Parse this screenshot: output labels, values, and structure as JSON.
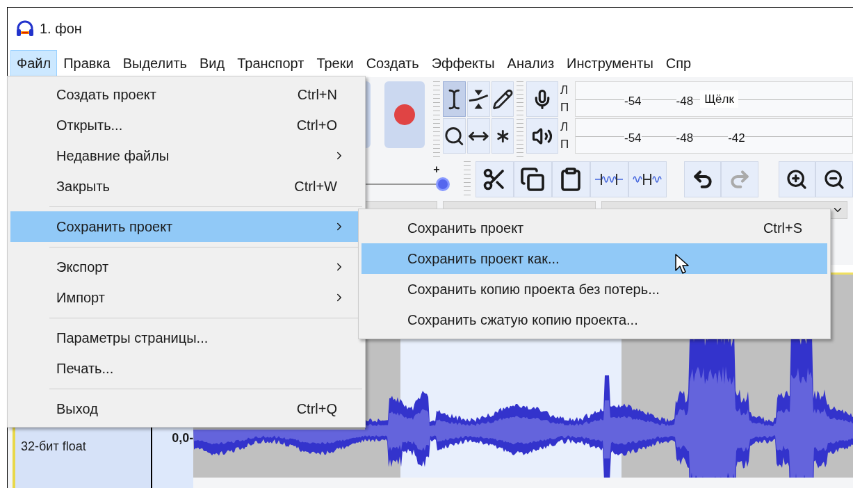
{
  "window": {
    "title": "1. фон"
  },
  "menu_bar": [
    {
      "label": "Файл",
      "selected": true
    },
    {
      "label": "Правка",
      "selected": false
    },
    {
      "label": "Выделить",
      "selected": false
    },
    {
      "label": "Вид",
      "selected": false
    },
    {
      "label": "Транспорт",
      "selected": false
    },
    {
      "label": "Треки",
      "selected": false
    },
    {
      "label": "Создать",
      "selected": false
    },
    {
      "label": "Эффекты",
      "selected": false
    },
    {
      "label": "Анализ",
      "selected": false
    },
    {
      "label": "Инструменты",
      "selected": false
    },
    {
      "label": "Спр",
      "selected": false
    }
  ],
  "tools": [
    {
      "selected": true
    },
    {
      "selected": false
    },
    {
      "selected": false
    },
    {
      "selected": false
    },
    {
      "selected": false
    },
    {
      "selected": false
    }
  ],
  "meters": [
    {
      "channels": [
        "Л",
        "П"
      ],
      "scale": [
        "-54",
        "-48"
      ],
      "hint": "Щёлк"
    },
    {
      "channels": [
        "Л",
        "П"
      ],
      "scale": [
        "-54",
        "-48",
        "-42"
      ]
    }
  ],
  "slider": {
    "mark": "+",
    "level": 1
  },
  "file_menu": [
    {
      "kind": "item",
      "label": "Создать проект",
      "shortcut": "Ctrl+N",
      "submenu": false,
      "selected": false
    },
    {
      "kind": "item",
      "label": "Открыть...",
      "shortcut": "Ctrl+O",
      "submenu": false,
      "selected": false
    },
    {
      "kind": "item",
      "label": "Недавние файлы",
      "submenu": true,
      "selected": false
    },
    {
      "kind": "item",
      "label": "Закрыть",
      "shortcut": "Ctrl+W",
      "submenu": false,
      "selected": false
    },
    {
      "kind": "separator"
    },
    {
      "kind": "item",
      "label": "Сохранить проект",
      "submenu": true,
      "selected": true
    },
    {
      "kind": "separator"
    },
    {
      "kind": "item",
      "label": "Экспорт",
      "submenu": true,
      "selected": false
    },
    {
      "kind": "item",
      "label": "Импорт",
      "submenu": true,
      "selected": false
    },
    {
      "kind": "separator"
    },
    {
      "kind": "item",
      "label": "Параметры страницы...",
      "submenu": false,
      "selected": false
    },
    {
      "kind": "item",
      "label": "Печать...",
      "submenu": false,
      "selected": false
    },
    {
      "kind": "separator"
    },
    {
      "kind": "item",
      "label": "Выход",
      "shortcut": "Ctrl+Q",
      "submenu": false,
      "selected": false
    }
  ],
  "save_submenu": [
    {
      "label": "Сохранить проект",
      "shortcut": "Ctrl+S",
      "selected": false
    },
    {
      "label": "Сохранить проект как...",
      "selected": true
    },
    {
      "label": "Сохранить копию проекта без потерь...",
      "selected": false
    },
    {
      "label": "Сохранить сжатую копию проекта...",
      "selected": false
    }
  ],
  "track": {
    "info": "32-бит float",
    "scale_label": "0,0-"
  }
}
